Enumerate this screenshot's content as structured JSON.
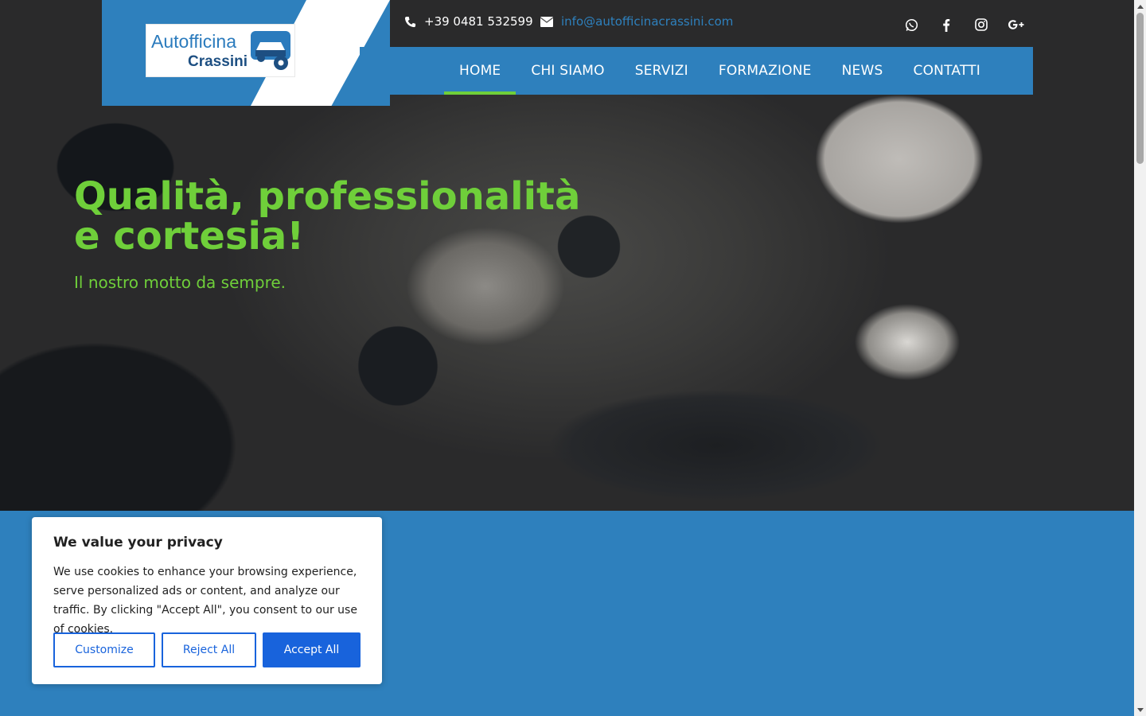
{
  "header": {
    "logo": {
      "line1": "Autofficina",
      "line2": "Crassini"
    },
    "phone": "+39 0481 532599",
    "email": "info@autofficinacrassini.com",
    "social": [
      "whatsapp-icon",
      "facebook-icon",
      "instagram-icon",
      "google-plus-icon"
    ]
  },
  "nav": {
    "items": [
      {
        "label": "HOME",
        "active": true
      },
      {
        "label": "CHI SIAMO"
      },
      {
        "label": "SERVIZI"
      },
      {
        "label": "FORMAZIONE"
      },
      {
        "label": "NEWS"
      },
      {
        "label": "CONTATTI"
      }
    ]
  },
  "hero": {
    "title": "Qualità, professionalità e cortesia!",
    "subtitle": "Il nostro motto da sempre."
  },
  "cookie": {
    "title": "We value your privacy",
    "text": "We use cookies to enhance your browsing experience, serve personalized ads or content, and analyze our traffic. By clicking \"Accept All\", you consent to our use of cookies.",
    "customize": "Customize",
    "reject": "Reject All",
    "accept": "Accept All"
  },
  "colors": {
    "brand_blue": "#2e80bd",
    "accent_green": "#6fcf3a",
    "cookie_button": "#1863dc"
  }
}
